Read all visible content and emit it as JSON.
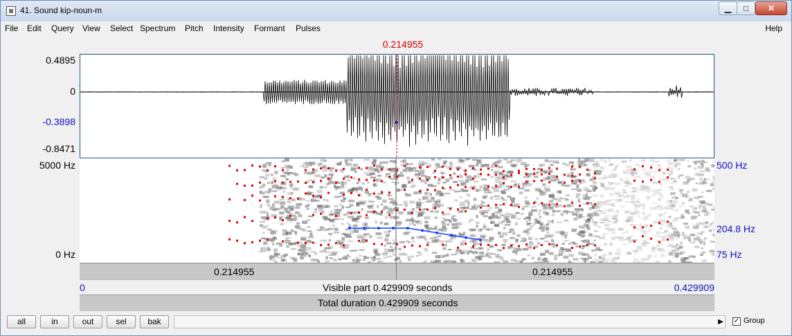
{
  "window": {
    "title": "41. Sound kip-noun-m",
    "minimize_glyph": "▁",
    "maximize_glyph": "□",
    "close_glyph": "✕"
  },
  "menu": {
    "items": [
      "File",
      "Edit",
      "Query",
      "View",
      "Select",
      "Spectrum",
      "Pitch",
      "Intensity",
      "Formant",
      "Pulses"
    ],
    "help": "Help"
  },
  "cursor": {
    "time_top": "0.214955"
  },
  "waveform": {
    "amp_top": "0.4895",
    "amp_zero": "0",
    "amp_cursor": "-0.3898",
    "amp_bottom": "-0.8471"
  },
  "spectrogram": {
    "freq_top_left": "5000 Hz",
    "freq_bottom_left": "0 Hz",
    "pitch_top_right": "500 Hz",
    "pitch_mid_right": "204.8 Hz",
    "pitch_bottom_right": "75 Hz"
  },
  "time_strip": {
    "left_value": "0.214955",
    "right_value": "0.214955"
  },
  "visible_strip": {
    "start": "0",
    "label": "Visible part 0.429909 seconds",
    "end": "0.429909"
  },
  "total_strip": {
    "label": "Total duration 0.429909 seconds"
  },
  "bottom": {
    "buttons": [
      "all",
      "in",
      "out",
      "sel",
      "bak"
    ],
    "scroll_left_glyph": "◀",
    "scroll_right_glyph": "▶",
    "group_label": "Group",
    "group_checked": "✓"
  },
  "colors": {
    "cursor": "#d00000",
    "pitch": "#1040ff",
    "formant": "#e00000",
    "axis_blue": "#1010c0"
  },
  "icons": {
    "app": "praat-sound-icon",
    "check": "check-icon"
  }
}
